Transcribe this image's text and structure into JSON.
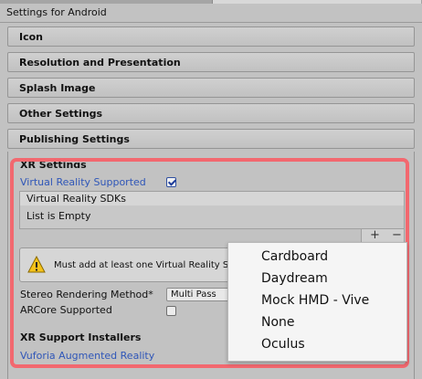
{
  "window": {
    "title": "Settings for Android"
  },
  "sections": [
    {
      "label": "Icon"
    },
    {
      "label": "Resolution and Presentation"
    },
    {
      "label": "Splash Image"
    },
    {
      "label": "Other Settings"
    },
    {
      "label": "Publishing Settings"
    }
  ],
  "xr": {
    "header": "XR Settings",
    "vr_supported_label": "Virtual Reality Supported",
    "vr_supported_checked": true,
    "sdk_list": {
      "header": "Virtual Reality SDKs",
      "empty_text": "List is Empty",
      "add": "+",
      "remove": "−"
    },
    "warning": "Must add at least one Virtual Reality S",
    "stereo_label": "Stereo Rendering Method*",
    "stereo_value": "Multi Pass",
    "arcore_label": "ARCore Supported",
    "arcore_checked": false,
    "installers_header": "XR Support Installers",
    "vuforia_link": "Vuforia Augmented Reality"
  },
  "dropdown_menu": {
    "items": [
      "Cardboard",
      "Daydream",
      "Mock HMD - Vive",
      "None",
      "Oculus"
    ]
  },
  "colors": {
    "highlight": "#f2686f",
    "link": "#2f56b8",
    "warning": "#f5c21b"
  }
}
